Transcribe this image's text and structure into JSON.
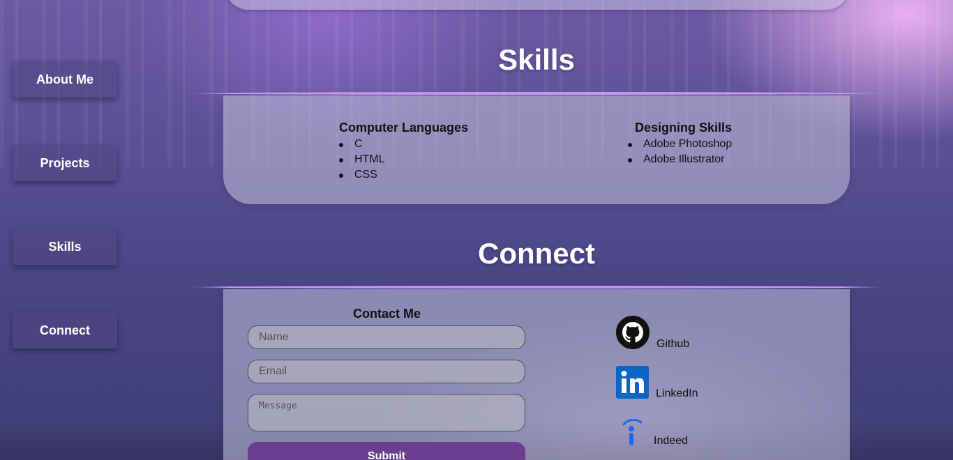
{
  "nav": {
    "about": "About Me",
    "projects": "Projects",
    "skills": "Skills",
    "connect": "Connect"
  },
  "skills": {
    "title": "Skills",
    "languages": {
      "heading": "Computer Languages",
      "items": [
        "C",
        "HTML",
        "CSS"
      ]
    },
    "design": {
      "heading": "Designing Skills",
      "items": [
        "Adobe Photoshop",
        "Adobe Illustrator"
      ]
    }
  },
  "connect": {
    "title": "Connect",
    "contact_heading": "Contact Me",
    "name_placeholder": "Name",
    "email_placeholder": "Email",
    "message_placeholder": "Message",
    "submit_label": "Submit",
    "links": {
      "github": "Github",
      "linkedin": "LinkedIn",
      "indeed": "Indeed"
    }
  },
  "icons": {
    "github": "github-icon",
    "linkedin": "linkedin-icon",
    "indeed": "indeed-icon"
  },
  "colors": {
    "accent": "#c79cf2",
    "submit_bg": "#6a3f8f",
    "linkedin": "#0a66c2",
    "indeed": "#2164f3"
  }
}
